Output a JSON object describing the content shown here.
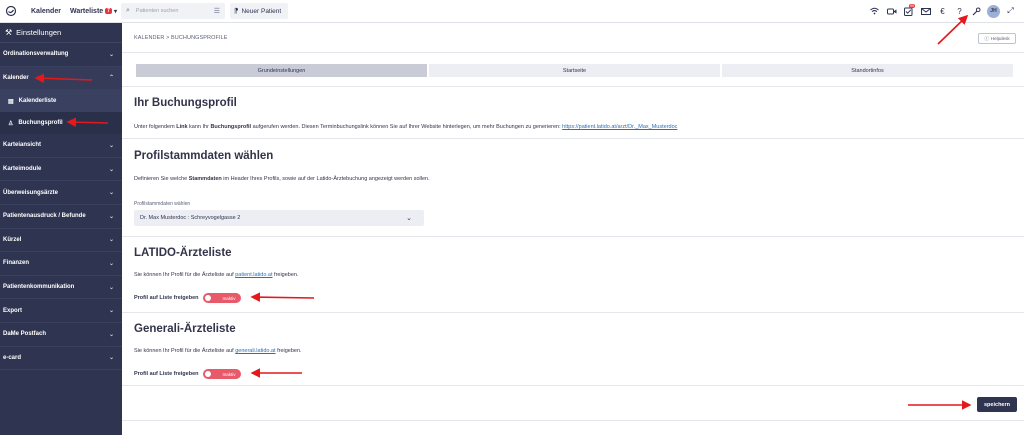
{
  "topbar": {
    "nav_calendar": "Kalender",
    "nav_waitlist": "Warteliste",
    "waitlist_badge": "7",
    "search_placeholder": "Patienten suchen",
    "new_patient": "Neuer Patient",
    "notification_count": "99",
    "avatar_initials": "JH"
  },
  "sidebar": {
    "title": "Einstellungen",
    "items": [
      {
        "label": "Ordinationsverwaltung"
      },
      {
        "label": "Kalender"
      },
      {
        "label": "Kalenderliste"
      },
      {
        "label": "Buchungsprofil"
      },
      {
        "label": "Karteiansicht"
      },
      {
        "label": "Karteimodule"
      },
      {
        "label": "Überweisungsärzte"
      },
      {
        "label": "Patientenausdruck / Befunde"
      },
      {
        "label": "Kürzel"
      },
      {
        "label": "Finanzen"
      },
      {
        "label": "Patientenkommunikation"
      },
      {
        "label": "Export"
      },
      {
        "label": "DaMe Postfach"
      },
      {
        "label": "e-card"
      }
    ]
  },
  "main": {
    "breadcrumb": "KALENDER > BUCHUNGSPROFILE",
    "helpdesk": "Helpdesk",
    "tabs": [
      {
        "label": "Grundeinstellungen"
      },
      {
        "label": "Startseite"
      },
      {
        "label": "Standortinfos"
      }
    ],
    "profile": {
      "title": "Ihr Buchungsprofil",
      "text_a": "Unter folgendem ",
      "text_b": "Link",
      "text_c": " kann Ihr ",
      "text_d": "Buchungsprofil",
      "text_e": " aufgerufen werden. Diesen Terminbuchungslink können Sie auf Ihrer Website hinterlegen, um mehr Buchungen zu generieren: ",
      "link": "https://patient.latido.at/arzt/Dr._Max_Musterdoc"
    },
    "stammdaten": {
      "title": "Profilstammdaten wählen",
      "text_a": "Definieren Sie welche ",
      "text_b": "Stammdaten",
      "text_c": " im Header Ihres Profils, sowie auf der Latido-Ärztebuchung angezeigt werden sollen.",
      "field_label": "Profilstammdaten wählen",
      "field_value": "Dr. Max Musterdoc : Schreyvogelgasse 2"
    },
    "latido": {
      "title": "LATIDO-Ärzteliste",
      "text_a": "Sie können Ihr Profil für die Ärzteliste auf ",
      "link": "patient.latido.at",
      "text_b": " freigeben.",
      "toggle_label": "Profil auf Liste freigeben",
      "toggle_state": "Inaktiv"
    },
    "generali": {
      "title": "Generali-Ärzteliste",
      "text_a": "Sie können Ihr Profil für die Ärzteliste auf ",
      "link": "generali.latido.at",
      "text_b": " freigeben.",
      "toggle_label": "Profil auf Liste freigeben",
      "toggle_state": "Inaktiv"
    },
    "save_label": "speichern"
  },
  "colors": {
    "sidebar_bg": "#2f3451",
    "toggle_inactive": "#e85a6a",
    "annotation_arrow": "#e3191c",
    "link": "#2f6fb3"
  }
}
